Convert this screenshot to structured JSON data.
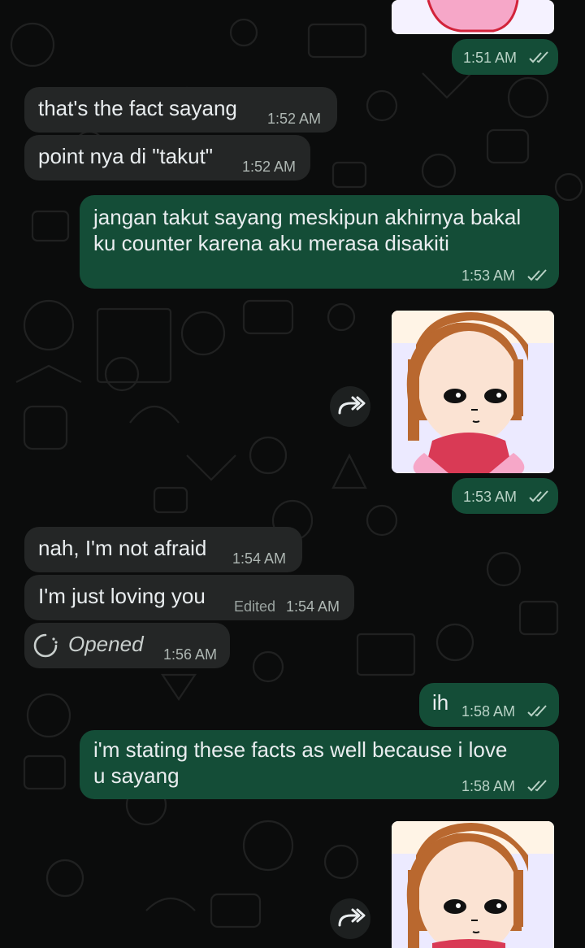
{
  "messages": [
    {
      "id": "m1",
      "type": "time_only",
      "direction": "outgoing",
      "time": "1:51 AM",
      "status": "read"
    },
    {
      "id": "m2",
      "type": "text",
      "direction": "incoming",
      "text": "that's the fact sayang",
      "time": "1:52 AM"
    },
    {
      "id": "m3",
      "type": "text",
      "direction": "incoming",
      "text": "point nya di \"takut\"",
      "time": "1:52 AM"
    },
    {
      "id": "m4",
      "type": "text",
      "direction": "outgoing",
      "lines": [
        "jangan takut sayang meskipun akhirnya bakal",
        "ku counter karena aku merasa disakiti"
      ],
      "time": "1:53 AM",
      "status": "read"
    },
    {
      "id": "m5",
      "type": "sticker",
      "direction": "outgoing",
      "description": "cartoon girl with brown hair sitting, wearing red shirt",
      "forward_icon": "forward-icon"
    },
    {
      "id": "m6",
      "type": "time_only",
      "direction": "outgoing",
      "time": "1:53 AM",
      "status": "read"
    },
    {
      "id": "m7",
      "type": "text",
      "direction": "incoming",
      "text": "nah, I'm not afraid",
      "time": "1:54 AM"
    },
    {
      "id": "m8",
      "type": "text",
      "direction": "incoming",
      "text": "I'm just loving you",
      "edited_label": "Edited",
      "time": "1:54 AM"
    },
    {
      "id": "m9",
      "type": "view_once",
      "direction": "incoming",
      "text": "Opened",
      "time": "1:56 AM",
      "icon": "view-once-icon"
    },
    {
      "id": "m10",
      "type": "text",
      "direction": "outgoing",
      "text": "ih",
      "time": "1:58 AM",
      "status": "read"
    },
    {
      "id": "m11",
      "type": "text",
      "direction": "outgoing",
      "lines": [
        "i'm stating these facts as well because i love",
        "u sayang"
      ],
      "time": "1:58 AM",
      "status": "read"
    },
    {
      "id": "m12",
      "type": "sticker",
      "direction": "outgoing",
      "description": "cartoon girl with brown hair, partially visible",
      "forward_icon": "forward-icon"
    }
  ],
  "colors": {
    "background": "#0b0c0c",
    "incoming_bubble": "#242626",
    "outgoing_bubble": "#144d37",
    "text": "#e9edef",
    "timestamp": "#aeb7b3",
    "read_ticks": "#b9d2c6"
  }
}
